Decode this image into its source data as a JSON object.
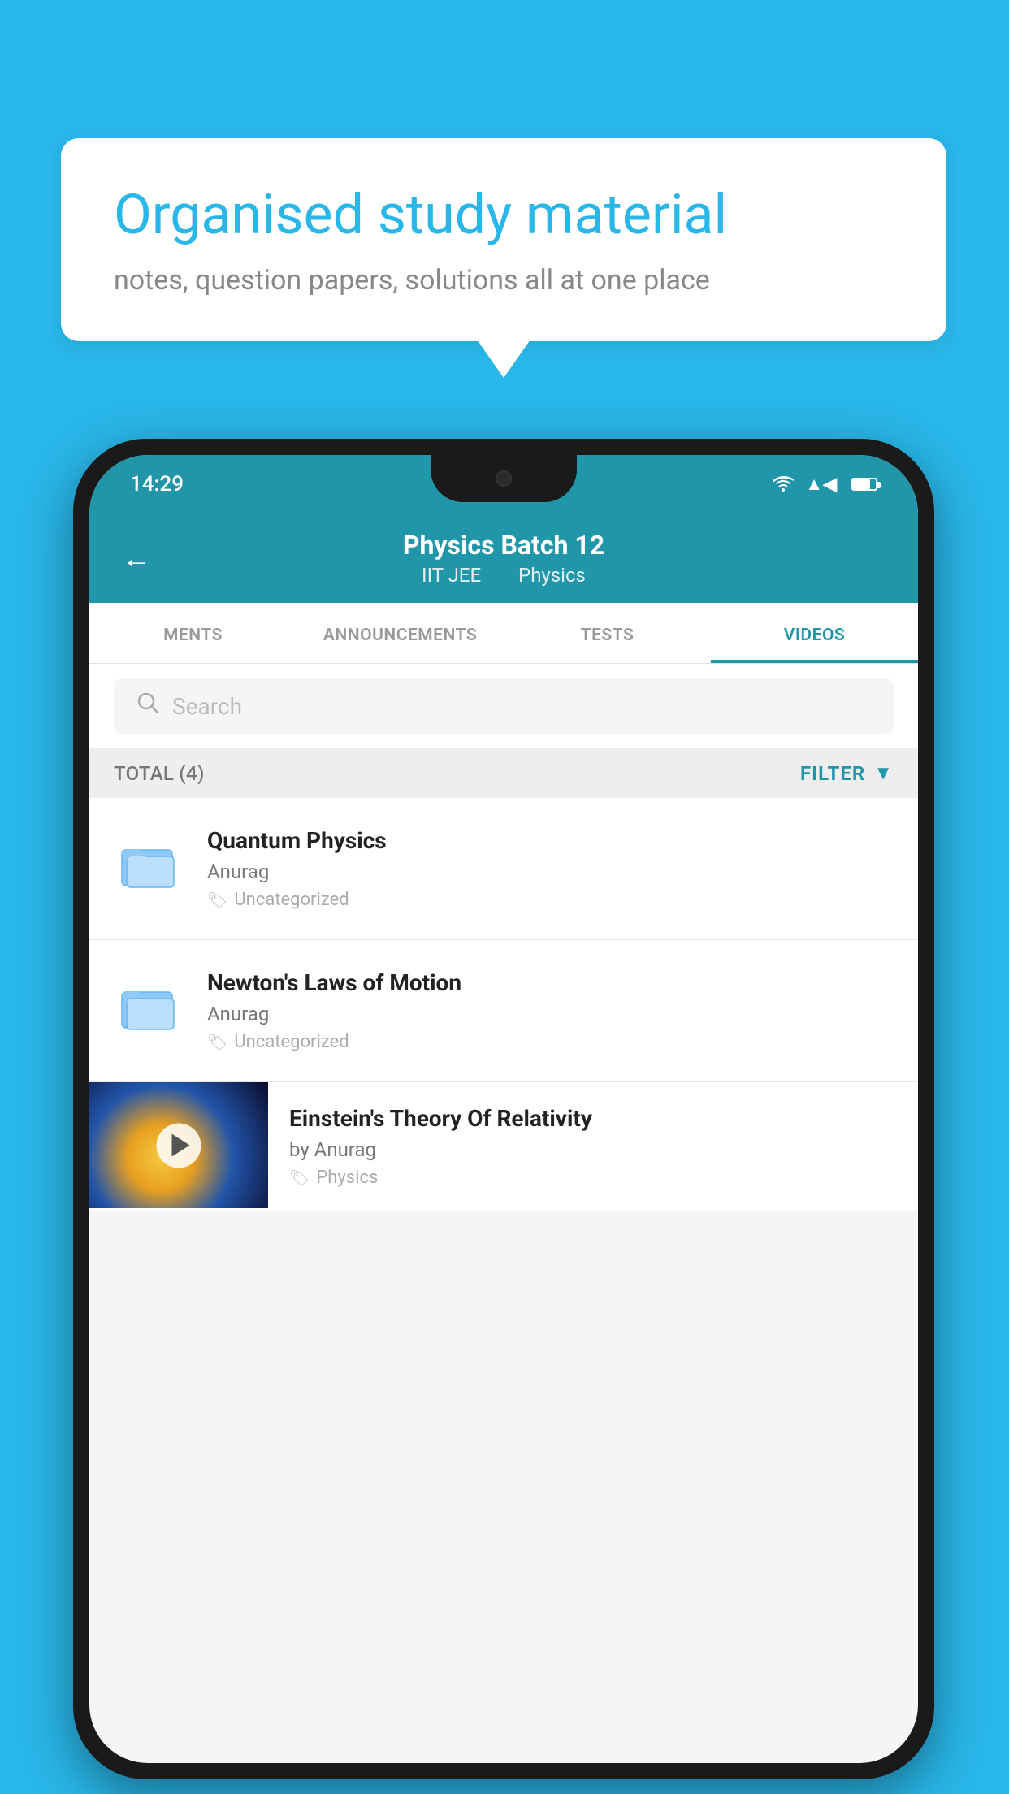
{
  "page": {
    "background_color": "#29b6e8"
  },
  "speech_bubble": {
    "title": "Organised study material",
    "subtitle": "notes, question papers, solutions all at one place"
  },
  "status_bar": {
    "time": "14:29",
    "wifi_icon": "▼",
    "signal_icon": "◀",
    "battery_icon": "▮"
  },
  "app_header": {
    "back_icon": "←",
    "title": "Physics Batch 12",
    "subtitle_part1": "IIT JEE",
    "subtitle_part2": "Physics"
  },
  "tabs": [
    {
      "label": "MENTS",
      "active": false
    },
    {
      "label": "ANNOUNCEMENTS",
      "active": false
    },
    {
      "label": "TESTS",
      "active": false
    },
    {
      "label": "VIDEOS",
      "active": true
    }
  ],
  "search": {
    "placeholder": "Search"
  },
  "filter_bar": {
    "total_label": "TOTAL (4)",
    "filter_label": "FILTER",
    "filter_icon": "▼"
  },
  "list_items": [
    {
      "id": "quantum-physics",
      "title": "Quantum Physics",
      "author": "Anurag",
      "tag": "Uncategorized",
      "type": "folder"
    },
    {
      "id": "newtons-laws",
      "title": "Newton's Laws of Motion",
      "author": "Anurag",
      "tag": "Uncategorized",
      "type": "folder"
    },
    {
      "id": "einstein-relativity",
      "title": "Einstein's Theory Of Relativity",
      "author": "by Anurag",
      "tag": "Physics",
      "type": "video"
    }
  ]
}
